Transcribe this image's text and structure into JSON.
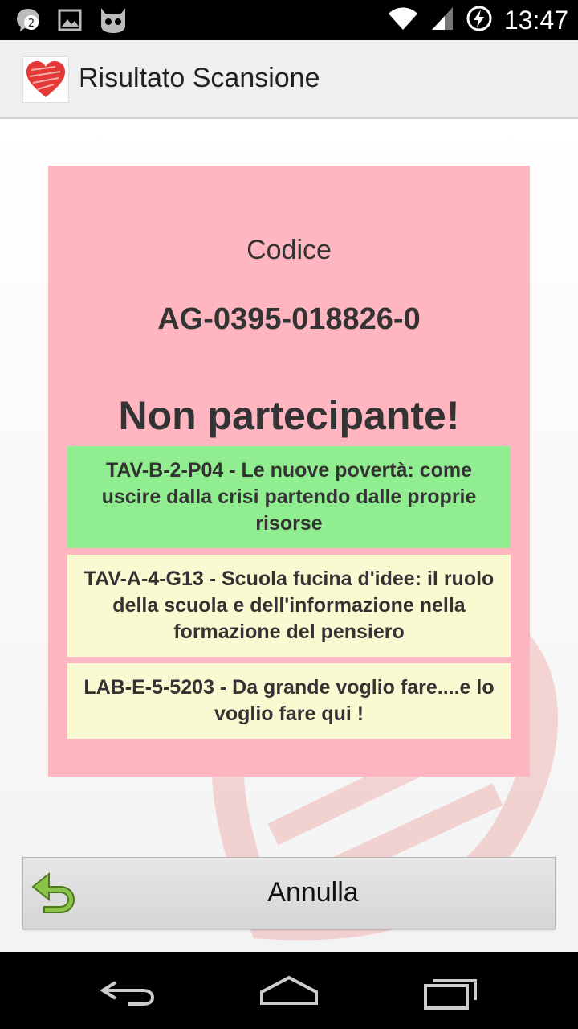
{
  "status_bar": {
    "notification_count": "2",
    "time": "13:47",
    "icons": [
      "messenger-notification-icon",
      "image-icon",
      "cyanogen-mascot-icon",
      "wifi-icon",
      "signal-icon",
      "battery-charging-icon"
    ]
  },
  "action_bar": {
    "title": "Risultato Scansione",
    "app_icon": "heart-icon"
  },
  "card": {
    "label": "Codice",
    "code": "AG-0395-018826-0",
    "status": "Non partecipante!",
    "background_color": "#ffb6c1",
    "events": [
      {
        "text": "TAV-B-2-P04 - Le nuove povertà: come uscire dalla crisi partendo dalle proprie risorse",
        "color": "#90ee90"
      },
      {
        "text": "TAV-A-4-G13 - Scuola fucina d'idee: il ruolo della scuola e dell'informazione nella formazione del pensiero",
        "color": "#fafad2"
      },
      {
        "text": "LAB-E-5-5203 - Da grande voglio fare....e lo voglio fare qui !",
        "color": "#fafad2"
      }
    ]
  },
  "cancel_button": {
    "label": "Annulla",
    "icon": "undo-arrow-icon"
  },
  "nav_bar": {
    "buttons": [
      "back-icon",
      "home-icon",
      "recents-icon"
    ]
  }
}
